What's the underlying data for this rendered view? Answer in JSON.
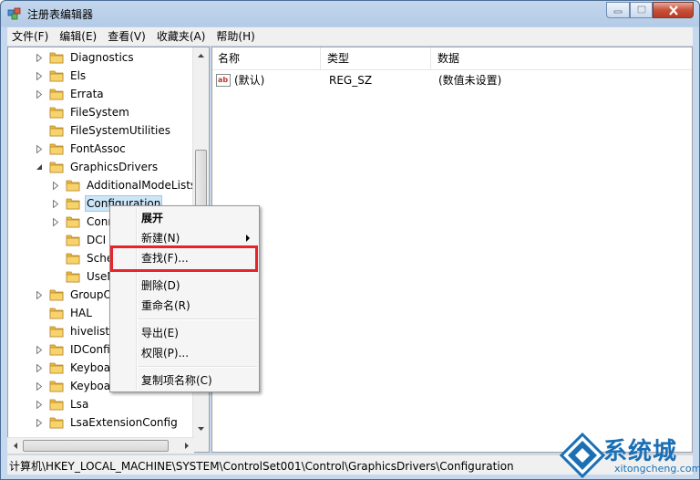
{
  "window": {
    "title": "注册表编辑器"
  },
  "menu": [
    "文件(F)",
    "编辑(E)",
    "查看(V)",
    "收藏夹(A)",
    "帮助(H)"
  ],
  "tree": [
    {
      "label": "Diagnostics",
      "indent": 0,
      "expander": "collapsed"
    },
    {
      "label": "Els",
      "indent": 0,
      "expander": "collapsed"
    },
    {
      "label": "Errata",
      "indent": 0,
      "expander": "collapsed"
    },
    {
      "label": "FileSystem",
      "indent": 0,
      "expander": "none"
    },
    {
      "label": "FileSystemUtilities",
      "indent": 0,
      "expander": "none"
    },
    {
      "label": "FontAssoc",
      "indent": 0,
      "expander": "collapsed"
    },
    {
      "label": "GraphicsDrivers",
      "indent": 0,
      "expander": "expanded"
    },
    {
      "label": "AdditionalModeLists",
      "indent": 1,
      "expander": "collapsed"
    },
    {
      "label": "Configuration",
      "indent": 1,
      "expander": "collapsed",
      "selected": true
    },
    {
      "label": "Conn",
      "indent": 1,
      "expander": "collapsed"
    },
    {
      "label": "DCI",
      "indent": 1,
      "expander": "none"
    },
    {
      "label": "Sche",
      "indent": 1,
      "expander": "none"
    },
    {
      "label": "UseN",
      "indent": 1,
      "expander": "none"
    },
    {
      "label": "GroupOr",
      "indent": 0,
      "expander": "collapsed"
    },
    {
      "label": "HAL",
      "indent": 0,
      "expander": "none"
    },
    {
      "label": "hivelist",
      "indent": 0,
      "expander": "none"
    },
    {
      "label": "IDConfig",
      "indent": 0,
      "expander": "collapsed"
    },
    {
      "label": "Keyboar",
      "indent": 0,
      "expander": "collapsed"
    },
    {
      "label": "Keyboar",
      "indent": 0,
      "expander": "collapsed"
    },
    {
      "label": "Lsa",
      "indent": 0,
      "expander": "collapsed"
    },
    {
      "label": "LsaExtensionConfig",
      "indent": 0,
      "expander": "collapsed"
    }
  ],
  "list": {
    "columns": [
      "名称",
      "类型",
      "数据"
    ],
    "rows": [
      {
        "name": "(默认)",
        "type": "REG_SZ",
        "data": "(数值未设置)"
      }
    ]
  },
  "context_menu": {
    "items": [
      {
        "label": "展开",
        "bold": true
      },
      {
        "label": "新建(N)",
        "submenu": true
      },
      {
        "label": "查找(F)...",
        "highlighted": true
      },
      {
        "separator": true
      },
      {
        "label": "删除(D)"
      },
      {
        "label": "重命名(R)"
      },
      {
        "separator": true
      },
      {
        "label": "导出(E)"
      },
      {
        "label": "权限(P)..."
      },
      {
        "separator": true
      },
      {
        "label": "复制项名称(C)"
      }
    ]
  },
  "status": {
    "path": "计算机\\HKEY_LOCAL_MACHINE\\SYSTEM\\ControlSet001\\Control\\GraphicsDrivers\\Configuration"
  },
  "watermark": {
    "cn": "系统城",
    "en": "xitongcheng.com"
  },
  "colors": {
    "highlight": "#e8232a",
    "selection": "#cde6f7",
    "folder": "#e8b93c",
    "watermark": "#1a6fb5"
  }
}
